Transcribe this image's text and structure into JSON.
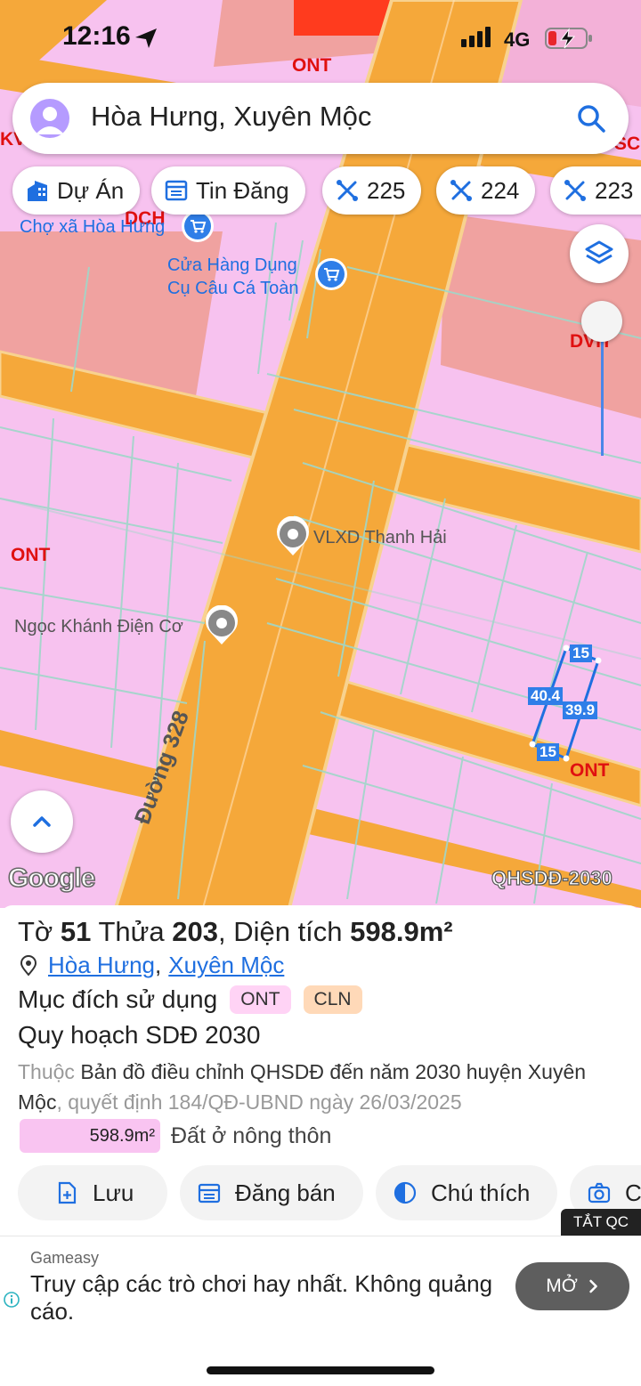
{
  "status_bar": {
    "time": "12:16",
    "network": "4G"
  },
  "search": {
    "query": "Hòa Hưng, Xuyên Mộc"
  },
  "chips": [
    {
      "label": "Dự Án",
      "icon": "building-icon"
    },
    {
      "label": "Tin Đăng",
      "icon": "listing-icon"
    },
    {
      "label": "225",
      "icon": "map-tool-icon"
    },
    {
      "label": "224",
      "icon": "map-tool-icon"
    },
    {
      "label": "223",
      "icon": "map-tool-icon"
    }
  ],
  "map": {
    "pois": {
      "market": "Chợ xã Hòa Hưng",
      "store_line1": "Cửa Hàng Dụng",
      "store_line2": "Cụ Câu Cá Toàn",
      "vlxd": "VLXD Thanh Hải",
      "electric": "Ngọc Khánh Điện Cơ"
    },
    "zones": {
      "ont_top": "ONT",
      "ont_left": "ONT",
      "ont_right": "ONT",
      "dch": "DCH",
      "dvh": "DVH",
      "edge_left": "KV",
      "edge_right": "SC"
    },
    "road_label": "Đường 328",
    "dimensions": {
      "top": "15",
      "left": "40.4",
      "right": "39.9",
      "bottom": "15"
    },
    "google_logo": "Google",
    "layer_label": "QHSDĐ-2030"
  },
  "parcel": {
    "sheet_prefix": "Tờ",
    "sheet_no": "51",
    "plot_prefix": "Thửa",
    "plot_no": "203",
    "area_prefix": ", Diện tích",
    "area": "598.9m²",
    "commune": "Hòa Hưng",
    "district": "Xuyên Mộc",
    "purpose_label": "Mục đích sử dụng",
    "purpose_codes": [
      "ONT",
      "CLN"
    ],
    "plan_title": "Quy hoạch SDĐ 2030",
    "plan_desc_prefix": "Thuộc",
    "plan_desc_main": "Bản đồ điều chỉnh QHSDĐ đến năm 2030 huyện Xuyên Mộc",
    "plan_desc_suffix": ", quyết định 184/QĐ-UBND ngày 26/03/2025",
    "area_value": "598.9m²",
    "area_type": "Đất ở nông thôn"
  },
  "actions": [
    {
      "label": "Lưu",
      "icon": "save-icon"
    },
    {
      "label": "Đăng bán",
      "icon": "post-icon"
    },
    {
      "label": "Chú thích",
      "icon": "legend-icon"
    },
    {
      "label": "C",
      "icon": "camera-icon"
    }
  ],
  "ad": {
    "close_label": "TẮT QC",
    "source": "Gameasy",
    "message": "Truy cập các trò chơi hay nhất. Không quảng cáo.",
    "open_label": "MỞ"
  },
  "colors": {
    "residential": "#f7c2ef",
    "road": "#f5a83a",
    "commercial": "#f0a2a0",
    "accent_blue": "#1f6fe0"
  }
}
